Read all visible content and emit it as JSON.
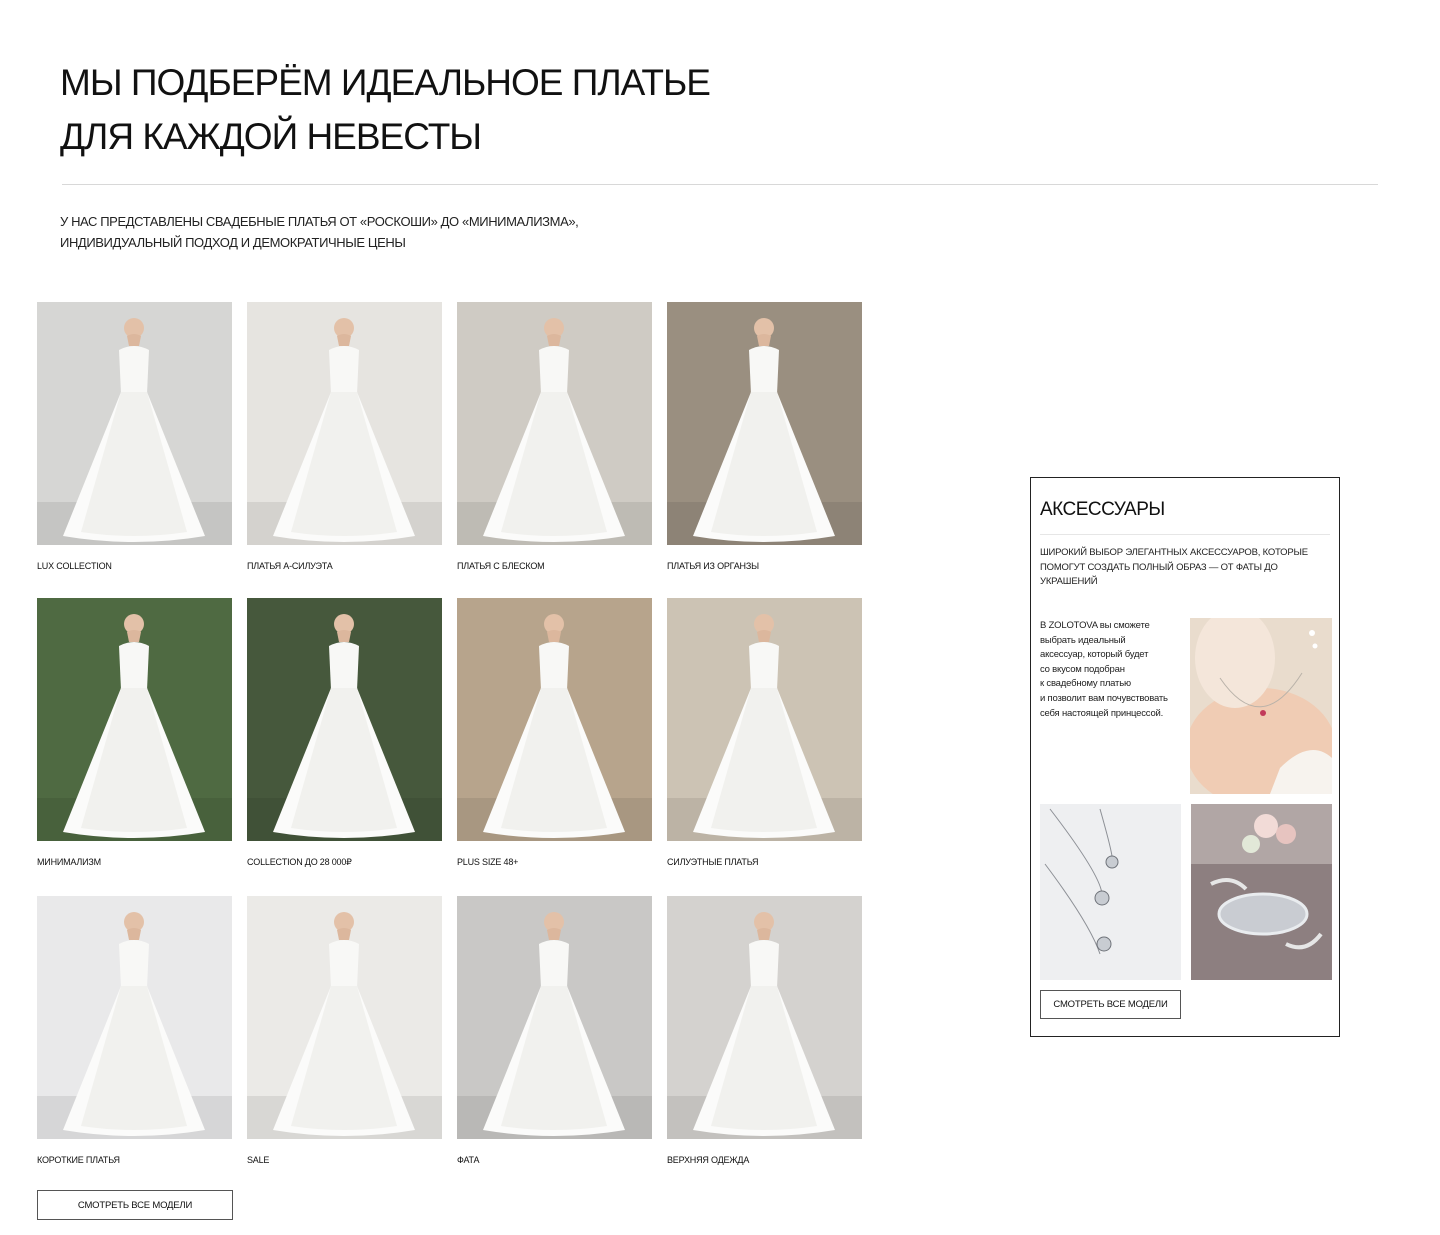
{
  "hero": {
    "title_line1": "МЫ ПОДБЕРЁМ ИДЕАЛЬНОЕ ПЛАТЬЕ",
    "title_line2": "ДЛЯ КАЖДОЙ НЕВЕСТЫ",
    "intro_line1": "У НАС ПРЕДСТАВЛЕНЫ СВАДЕБНЫЕ ПЛАТЬЯ ОТ «РОСКОШИ» ДО «МИНИМАЛИЗМА»,",
    "intro_line2": "ИНДИВИДУАЛЬНЫЙ ПОДХОД И ДЕМОКРАТИЧНЫЕ ЦЕНЫ"
  },
  "categories": [
    {
      "label": "LUX COLLECTION",
      "bg": "#d6d6d4"
    },
    {
      "label": "ПЛАТЬЯ А-СИЛУЭТА",
      "bg": "#e6e4e0"
    },
    {
      "label": "ПЛАТЬЯ С БЛЕСКОМ",
      "bg": "#cfcbc4"
    },
    {
      "label": "ПЛАТЬЯ ИЗ ОРГАНЗЫ",
      "bg": "#9a8f80"
    },
    {
      "label": "МИНИМАЛИЗМ",
      "bg": "#4f6a42"
    },
    {
      "label": "COLLECTION ДО 28 000₽",
      "bg": "#46583c"
    },
    {
      "label": "PLUS SIZE 48+",
      "bg": "#b7a48c"
    },
    {
      "label": "СИЛУЭТНЫЕ ПЛАТЬЯ",
      "bg": "#ccc3b4"
    },
    {
      "label": "КОРОТКИЕ ПЛАТЬЯ",
      "bg": "#e9e9ea"
    },
    {
      "label": "SALE",
      "bg": "#ebeae7"
    },
    {
      "label": "ФАТА",
      "bg": "#c9c8c6"
    },
    {
      "label": "ВЕРХНЯЯ ОДЕЖДА",
      "bg": "#d4d2cf"
    }
  ],
  "see_all_label": "СМОТРЕТЬ ВСЕ МОДЕЛИ",
  "accessories": {
    "title": "АКСЕССУАРЫ",
    "description": "ШИРОКИЙ ВЫБОР ЭЛЕГАНТНЫХ АКСЕССУАРОВ, КОТОРЫЕ ПОМОГУТ СОЗДАТЬ ПОЛНЫЙ ОБРАЗ — ОТ ФАТЫ ДО УКРАШЕНИЙ",
    "text_lines": [
      "В ZOLOTOVA вы сможете",
      "выбрать идеальный",
      "аксессуар, который будет",
      "со вкусом подобран",
      "к свадебному платью",
      "и позволит вам почувствовать",
      "себя настоящей принцессой."
    ],
    "button_label": "СМОТРЕТЬ ВСЕ МОДЕЛИ"
  }
}
